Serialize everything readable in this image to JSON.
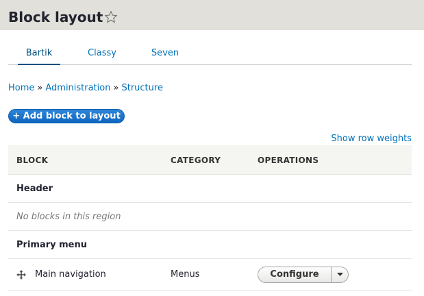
{
  "header": {
    "title": "Block layout",
    "star_icon": "star-outline-icon"
  },
  "tabs": [
    {
      "label": "Bartik",
      "active": true
    },
    {
      "label": "Classy",
      "active": false
    },
    {
      "label": "Seven",
      "active": false
    }
  ],
  "breadcrumb": {
    "items": [
      "Home",
      "Administration",
      "Structure"
    ],
    "separator": "»"
  },
  "actions": {
    "add_block_label": "+ Add block to layout",
    "row_weights_label": "Show row weights"
  },
  "table": {
    "columns": [
      "BLOCK",
      "CATEGORY",
      "OPERATIONS"
    ],
    "regions": [
      {
        "title": "Header",
        "empty_message": "No blocks in this region"
      },
      {
        "title": "Primary menu"
      }
    ],
    "blocks": [
      {
        "name": "Main navigation",
        "category": "Menus",
        "operation": "Configure",
        "icon": "drag-handle-icon"
      }
    ]
  },
  "colors": {
    "header_bg": "#e1e0da",
    "link": "#0071b8",
    "primary_button": "#1b6fc2",
    "table_header_bg": "#f5f5f2"
  }
}
